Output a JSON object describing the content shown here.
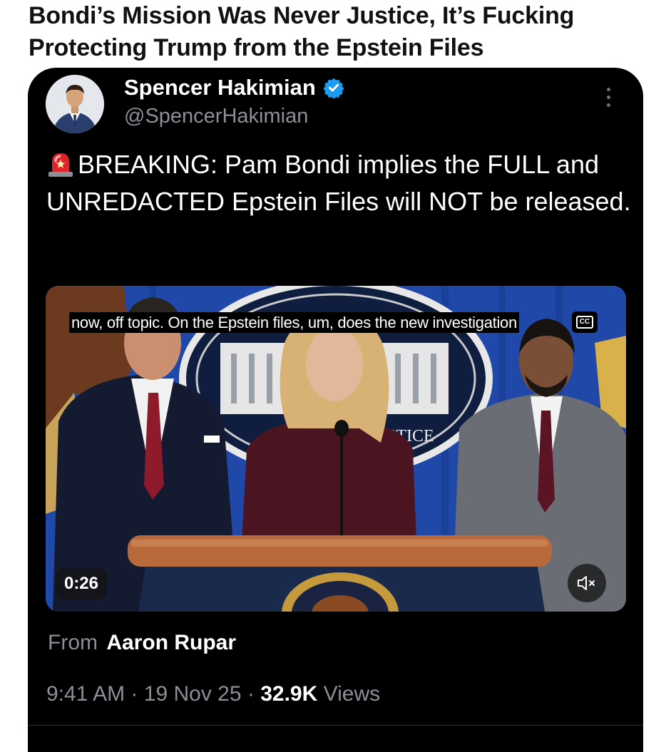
{
  "headline": {
    "line1": "Bondi’s Mission Was Never Justice, It’s Fucking",
    "line2": "Protecting Trump from the Epstein Files"
  },
  "tweet": {
    "author_name": "Spencer Hakimian",
    "handle": "@SpencerHakimian",
    "text": "BREAKING: Pam Bondi implies the FULL and UNREDACTED Epstein Files will NOT be released.",
    "from_label": "From",
    "from_name": "Aaron Rupar",
    "time": "9:41 AM",
    "date": "19 Nov 25",
    "views_count": "32.9K",
    "views_label": "Views",
    "separator": "·"
  },
  "video": {
    "caption": "now, off topic. On the Epstein files, um, does the new investigation",
    "cc_label": "CC",
    "duration": "0:26",
    "backdrop_text": "ISTICE"
  },
  "icons": {
    "verified": "verified-badge-icon",
    "siren": "siren-emoji-icon",
    "more": "more-vertical-icon",
    "cc": "closed-captions-icon",
    "mute": "muted-speaker-icon"
  },
  "colors": {
    "verified": "#1d9bf0",
    "card_bg": "#000000",
    "muted_text": "#8b8f96"
  }
}
